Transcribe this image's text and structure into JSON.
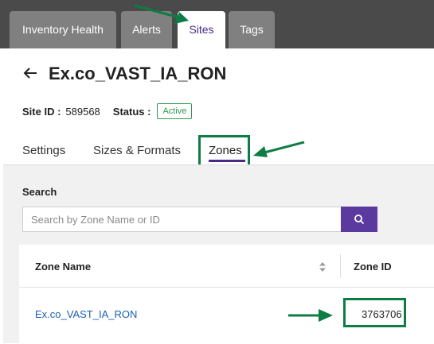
{
  "top_tabs": [
    {
      "label": "Inventory Health",
      "active": false
    },
    {
      "label": "Alerts",
      "active": false
    },
    {
      "label": "Sites",
      "active": true
    },
    {
      "label": "Tags",
      "active": false
    }
  ],
  "header": {
    "title": "Ex.co_VAST_IA_RON",
    "site_id_label": "Site ID :",
    "site_id": "589568",
    "status_label": "Status :",
    "status": "Active"
  },
  "sub_tabs": [
    {
      "label": "Settings",
      "active": false
    },
    {
      "label": "Sizes & Formats",
      "active": false
    },
    {
      "label": "Zones",
      "active": true
    }
  ],
  "search": {
    "label": "Search",
    "placeholder": "Search by Zone Name or ID",
    "value": ""
  },
  "table": {
    "columns": [
      "Zone Name",
      "Zone ID"
    ],
    "rows": [
      {
        "zone_name": "Ex.co_VAST_IA_RON",
        "zone_id": "3763706"
      }
    ]
  },
  "colors": {
    "topbar": "#4a4a4a",
    "inactive_tab": "#808080",
    "accent_purple": "#4b2a85",
    "search_button": "#5b3aa0",
    "status_green": "#2e9a4c",
    "annotation_green": "#0e7c45",
    "link_blue": "#1a5fb4"
  }
}
